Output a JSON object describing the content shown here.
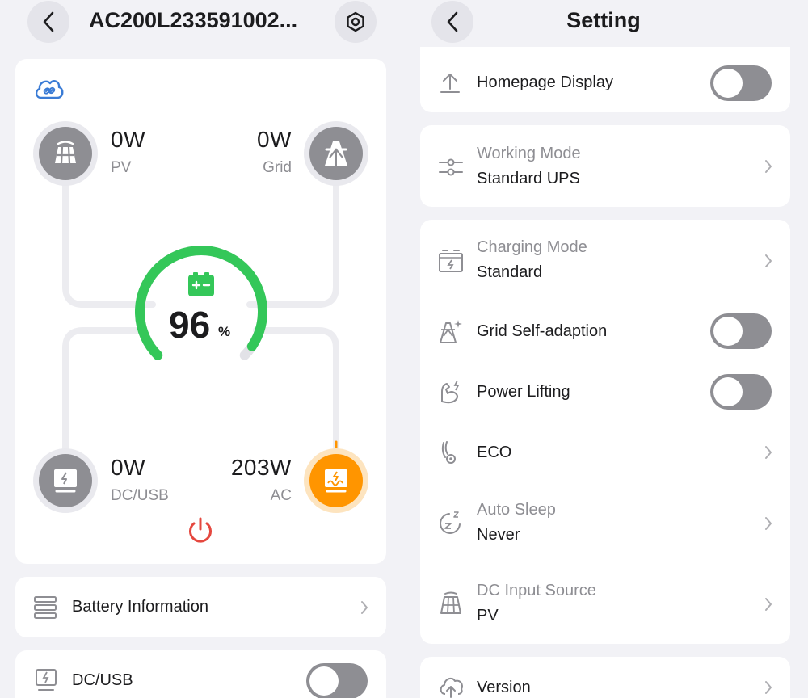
{
  "left_panel": {
    "device_title": "AC200L233591002...",
    "icons": {
      "back": "chevron-left-icon",
      "settings": "hexagon-gear-icon",
      "cloud": "cloud-link-icon",
      "battery": "battery-icon",
      "power": "power-icon"
    },
    "battery": {
      "percent": "96",
      "unit": "%",
      "gauge_fraction": 0.96,
      "color": "#34c759"
    },
    "flows": {
      "pv": {
        "value": "0W",
        "label": "PV"
      },
      "grid": {
        "value": "0W",
        "label": "Grid"
      },
      "dc_usb": {
        "value": "0W",
        "label": "DC/USB"
      },
      "ac": {
        "value": "203W",
        "label": "AC",
        "active": true
      }
    },
    "battery_info": {
      "label": "Battery Information"
    },
    "dc_usb_switch": {
      "label": "DC/USB",
      "on": false
    }
  },
  "right_panel": {
    "title": "Setting",
    "homepage_display": {
      "label": "Homepage Display",
      "on": false
    },
    "working_mode": {
      "label": "Working Mode",
      "value": "Standard UPS"
    },
    "charging_mode": {
      "label": "Charging Mode",
      "value": "Standard"
    },
    "grid_self_adaption": {
      "label": "Grid Self-adaption",
      "on": false
    },
    "power_lifting": {
      "label": "Power Lifting",
      "on": false
    },
    "eco": {
      "label": "ECO"
    },
    "auto_sleep": {
      "label": "Auto Sleep",
      "value": "Never"
    },
    "dc_input_source": {
      "label": "DC Input Source",
      "value": "PV"
    },
    "version": {
      "label": "Version"
    }
  },
  "colors": {
    "accent_green": "#34c759",
    "ac_orange": "#ff9500",
    "power_red": "#e5483f",
    "cloud_blue": "#3a7bd5",
    "toggle_off": "#8e8e93"
  }
}
